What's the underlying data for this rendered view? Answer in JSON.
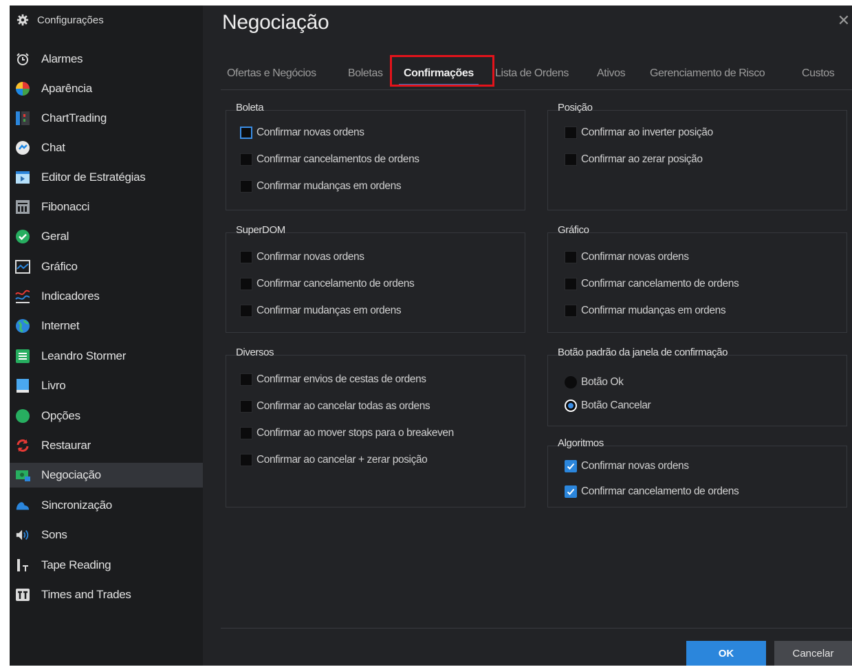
{
  "sidebar": {
    "title": "Configurações",
    "items": [
      {
        "label": "Alarmes",
        "icon": "alarm-clock-icon"
      },
      {
        "label": "Aparência",
        "icon": "palette-icon"
      },
      {
        "label": "ChartTrading",
        "icon": "chart-trading-icon"
      },
      {
        "label": "Chat",
        "icon": "chat-icon"
      },
      {
        "label": "Editor de Estratégias",
        "icon": "strategy-editor-icon"
      },
      {
        "label": "Fibonacci",
        "icon": "fibonacci-icon"
      },
      {
        "label": "Geral",
        "icon": "check-circle-icon"
      },
      {
        "label": "Gráfico",
        "icon": "chart-icon"
      },
      {
        "label": "Indicadores",
        "icon": "indicators-icon"
      },
      {
        "label": "Internet",
        "icon": "globe-icon"
      },
      {
        "label": "Leandro Stormer",
        "icon": "profile-card-icon"
      },
      {
        "label": "Livro",
        "icon": "book-icon"
      },
      {
        "label": "Opções",
        "icon": "options-icon"
      },
      {
        "label": "Restaurar",
        "icon": "restore-icon"
      },
      {
        "label": "Negociação",
        "icon": "trading-icon"
      },
      {
        "label": "Sincronização",
        "icon": "cloud-icon"
      },
      {
        "label": "Sons",
        "icon": "speaker-icon"
      },
      {
        "label": "Tape Reading",
        "icon": "tape-reading-icon"
      },
      {
        "label": "Times and Trades",
        "icon": "times-trades-icon"
      }
    ],
    "active_item": "Negociação"
  },
  "main": {
    "title": "Negociação",
    "tabs": [
      "Ofertas e Negócios",
      "Boletas",
      "Confirmações",
      "Lista de Ordens",
      "Ativos",
      "Gerenciamento de Risco",
      "Custos"
    ],
    "active_tab": "Confirmações"
  },
  "groups": {
    "boleta": {
      "title": "Boleta",
      "options": [
        "Confirmar novas ordens",
        "Confirmar cancelamentos de ordens",
        "Confirmar mudanças em ordens"
      ]
    },
    "posicao": {
      "title": "Posição",
      "options": [
        "Confirmar ao inverter posição",
        "Confirmar ao zerar posição"
      ]
    },
    "superdom": {
      "title": "SuperDOM",
      "options": [
        "Confirmar novas ordens",
        "Confirmar cancelamento de ordens",
        "Confirmar mudanças em ordens"
      ]
    },
    "grafico": {
      "title": "Gráfico",
      "options": [
        "Confirmar novas ordens",
        "Confirmar cancelamento de ordens",
        "Confirmar mudanças em ordens"
      ]
    },
    "diversos": {
      "title": "Diversos",
      "options": [
        "Confirmar envios de cestas de ordens",
        "Confirmar ao cancelar todas as ordens",
        "Confirmar ao mover stops para o breakeven",
        "Confirmar ao cancelar + zerar posição"
      ]
    },
    "botao_padrao": {
      "title": "Botão padrão da janela de confirmação",
      "options": [
        "Botão Ok",
        "Botão Cancelar"
      ],
      "selected": "Botão Cancelar"
    },
    "algoritmos": {
      "title": "Algoritmos",
      "options": [
        "Confirmar novas ordens",
        "Confirmar cancelamento de ordens"
      ],
      "checked": [
        true,
        true
      ]
    }
  },
  "buttons": {
    "ok": "OK",
    "cancel": "Cancelar"
  },
  "colors": {
    "accent": "#2b86dc",
    "highlight": "#e4131b",
    "background": "#222326",
    "sidebar": "#1b1c1e"
  }
}
